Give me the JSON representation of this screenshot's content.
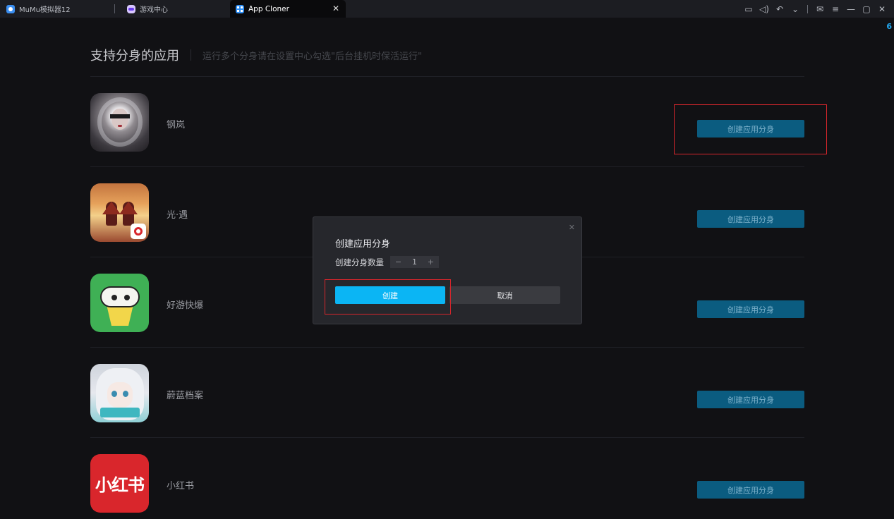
{
  "titlebar": {
    "tabs": [
      {
        "label": "MuMu模拟器12"
      },
      {
        "label": "游戏中心"
      },
      {
        "label": "App Cloner",
        "close": "✕"
      }
    ],
    "controls": {
      "keyboard": "▭",
      "volume": "◁)",
      "back": "↶",
      "dropdown": "⌄",
      "mail": "✉",
      "menu": "≡",
      "minimize": "—",
      "maximize": "▢",
      "close": "✕"
    },
    "counter": "6"
  },
  "header": {
    "title": "支持分身的应用",
    "hint": "运行多个分身请在设置中心勾选\"后台挂机时保活运行\""
  },
  "apps": [
    {
      "name": "钢岚",
      "button": "创建应用分身"
    },
    {
      "name": "光·遇",
      "button": "创建应用分身"
    },
    {
      "name": "好游快爆",
      "button": "创建应用分身"
    },
    {
      "name": "蔚蓝档案",
      "button": "创建应用分身"
    },
    {
      "name": "小红书",
      "button": "创建应用分身",
      "icon_text": "小红书"
    }
  ],
  "dialog": {
    "title": "创建应用分身",
    "count_label": "创建分身数量",
    "stepper": {
      "minus": "−",
      "value": "1",
      "plus": "+"
    },
    "create_label": "创建",
    "cancel_label": "取消",
    "close": "✕"
  },
  "colors": {
    "accent": "#0bb5f4",
    "clone_button": "#0b5c80",
    "highlight": "#d8262c",
    "background": "#111114"
  }
}
